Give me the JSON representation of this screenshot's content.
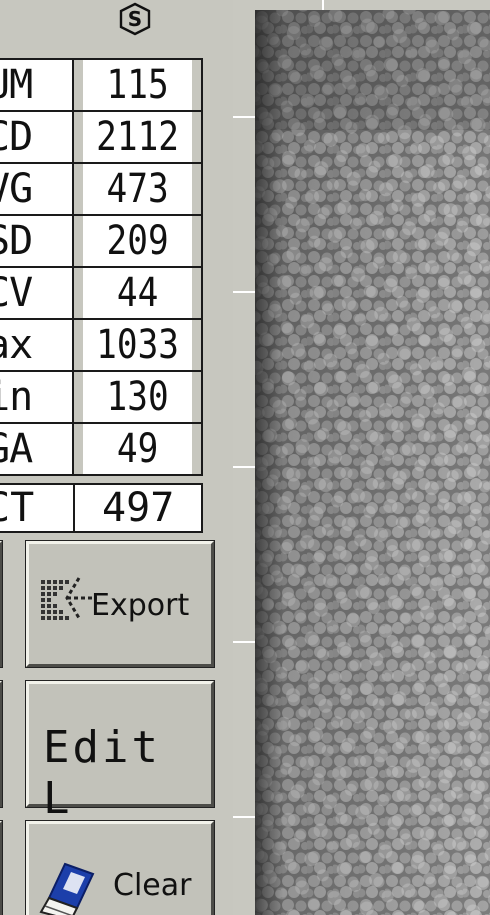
{
  "stats": [
    {
      "label": "UM",
      "value": "115"
    },
    {
      "label": "CD",
      "value": "2112"
    },
    {
      "label": "VG",
      "value": "473"
    },
    {
      "label": "SD",
      "value": "209"
    },
    {
      "label": "CV",
      "value": "44"
    },
    {
      "label": "ax",
      "value": "1033"
    },
    {
      "label": "in",
      "value": "130"
    },
    {
      "label": "GA",
      "value": "49"
    }
  ],
  "count": {
    "label": "CT",
    "value": "497"
  },
  "buttons": {
    "export": "Export",
    "edit": "Edit L",
    "clear": "Clear"
  },
  "icons": {
    "badge": "s-hexagon-icon",
    "export": "export-arrow-icon",
    "clear": "eraser-icon"
  },
  "colors": {
    "panel": "#c7c7bf",
    "cell": "#ffffff",
    "eraser": "#1c3faa"
  }
}
